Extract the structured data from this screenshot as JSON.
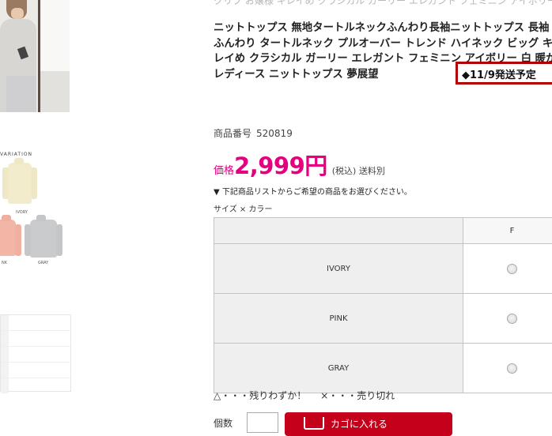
{
  "thumbnails": {
    "variation_title": "VARIATION",
    "variation_labels": [
      "IVORY",
      "NK",
      "GRAY"
    ]
  },
  "product": {
    "subtitle": "クリプ お嬢様 キレイめ クラシカル ガーリー エレガント フェミニン アイボリー 白 暖か レディース",
    "title": "ニットトップス 無地タートルネックふんわり長袖ニットトップス 長袖 ふんわり タートルネック プルオーバー トレンド ハイネック ビッグ キレイめ クラシカル ガーリー エレガント フェミニン アイボリー 白 暖か レディース ニットトップス 夢展望",
    "shipping_badge": "◆11/9発送予定",
    "item_number_label": "商品番号",
    "item_number": "520819",
    "price_label": "価格",
    "price_value": "2,999円",
    "price_tax": "(税込) 送料別",
    "notice": "▼ 下記商品リストからご希望の商品をお選びください。",
    "variation_label": "サイズ × カラー"
  },
  "stock_table": {
    "size_header": "F",
    "rows": [
      {
        "color": "IVORY"
      },
      {
        "color": "PINK"
      },
      {
        "color": "GRAY"
      }
    ]
  },
  "legend": {
    "low_stock": "△・・・残りわずか！",
    "sold_out": "×・・・売り切れ"
  },
  "purchase": {
    "qty_label": "個数",
    "cart_button": "カゴに入れる"
  }
}
